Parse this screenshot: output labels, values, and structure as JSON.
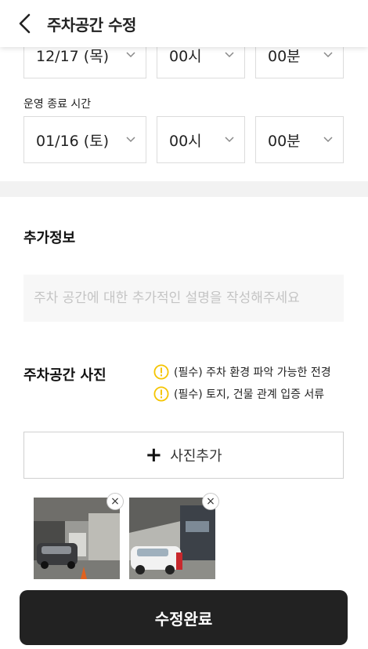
{
  "header": {
    "title": "주차공간 수정",
    "back_icon": "chevron-left-icon"
  },
  "start_time": {
    "date": "12/17 (목)",
    "hour": "00시",
    "minute": "00분"
  },
  "end_time": {
    "label": "운영 종료 시간",
    "date": "01/16 (토)",
    "hour": "00시",
    "minute": "00분"
  },
  "extra_info": {
    "title": "추가정보",
    "placeholder": "주차 공간에 대한 추가적인 설명을 작성해주세요",
    "value": ""
  },
  "photos": {
    "title": "주차공간 사진",
    "requirements": [
      "(필수) 주차 환경 파악 가능한 전경",
      "(필수) 토지, 건물 관계 입증 서류"
    ],
    "add_label": "사진추가",
    "remove_symbol": "×"
  },
  "submit_label": "수정완료",
  "colors": {
    "accent": "#222222",
    "warning": "#f5c400",
    "divider": "#f2f2f2"
  }
}
